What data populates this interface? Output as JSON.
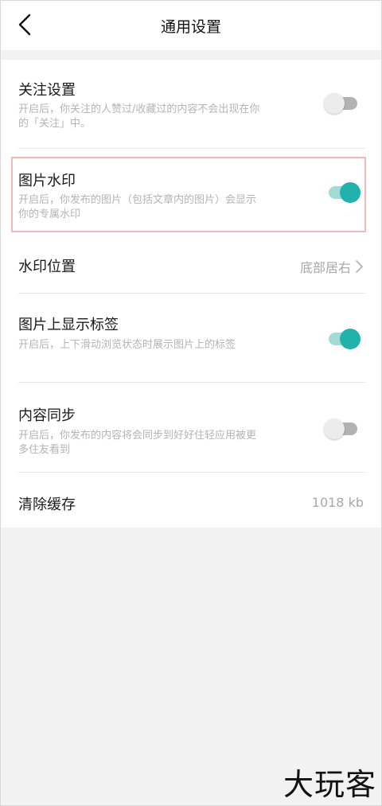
{
  "header": {
    "title": "通用设置"
  },
  "settings": {
    "follow": {
      "title": "关注设置",
      "desc": "开启后，你关注的人赞过/收藏过的内容不会出现在你的「关注」中。",
      "enabled": false
    },
    "watermark": {
      "title": "图片水印",
      "desc": "开启后，你发布的图片（包括文章内的图片）会显示你的专属水印",
      "enabled": true
    },
    "watermark_position": {
      "title": "水印位置",
      "value": "底部居右"
    },
    "image_tags": {
      "title": "图片上显示标签",
      "desc": "开启后，上下滑动浏览状态时展示图片上的标签",
      "enabled": true
    },
    "content_sync": {
      "title": "内容同步",
      "desc": "开启后，你发布的内容将会同步到好好住轻应用被更多住友看到",
      "enabled": false
    },
    "clear_cache": {
      "title": "清除缓存",
      "value": "1018 kb"
    }
  },
  "colors": {
    "accent": "#22b2ad",
    "accent_light": "#a3dbd7",
    "highlight_border": "#f1b8b8"
  },
  "icons": {
    "back": "chevron-left-icon",
    "arrow": "chevron-right-icon"
  },
  "watermark_logo": "大玩客"
}
